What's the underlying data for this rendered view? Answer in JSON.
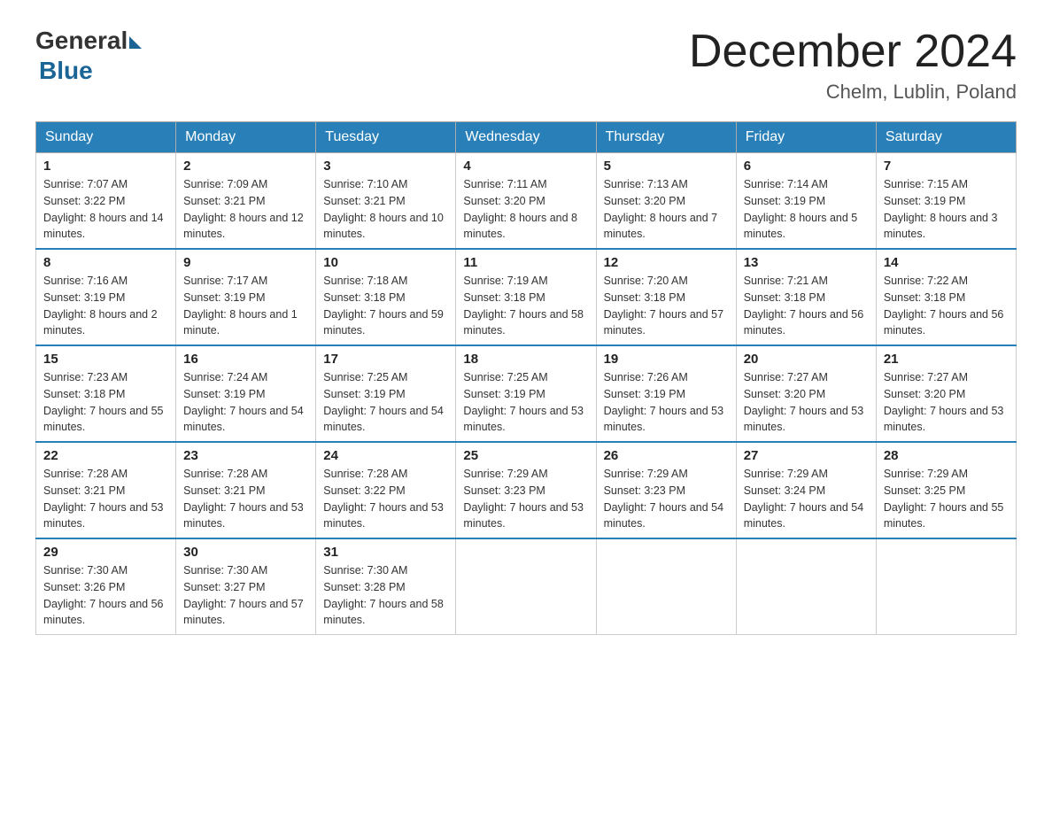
{
  "logo": {
    "general": "General",
    "blue": "Blue"
  },
  "title": {
    "month_year": "December 2024",
    "location": "Chelm, Lublin, Poland"
  },
  "days_of_week": [
    "Sunday",
    "Monday",
    "Tuesday",
    "Wednesday",
    "Thursday",
    "Friday",
    "Saturday"
  ],
  "weeks": [
    [
      {
        "day": "1",
        "sunrise": "7:07 AM",
        "sunset": "3:22 PM",
        "daylight": "8 hours and 14 minutes."
      },
      {
        "day": "2",
        "sunrise": "7:09 AM",
        "sunset": "3:21 PM",
        "daylight": "8 hours and 12 minutes."
      },
      {
        "day": "3",
        "sunrise": "7:10 AM",
        "sunset": "3:21 PM",
        "daylight": "8 hours and 10 minutes."
      },
      {
        "day": "4",
        "sunrise": "7:11 AM",
        "sunset": "3:20 PM",
        "daylight": "8 hours and 8 minutes."
      },
      {
        "day": "5",
        "sunrise": "7:13 AM",
        "sunset": "3:20 PM",
        "daylight": "8 hours and 7 minutes."
      },
      {
        "day": "6",
        "sunrise": "7:14 AM",
        "sunset": "3:19 PM",
        "daylight": "8 hours and 5 minutes."
      },
      {
        "day": "7",
        "sunrise": "7:15 AM",
        "sunset": "3:19 PM",
        "daylight": "8 hours and 3 minutes."
      }
    ],
    [
      {
        "day": "8",
        "sunrise": "7:16 AM",
        "sunset": "3:19 PM",
        "daylight": "8 hours and 2 minutes."
      },
      {
        "day": "9",
        "sunrise": "7:17 AM",
        "sunset": "3:19 PM",
        "daylight": "8 hours and 1 minute."
      },
      {
        "day": "10",
        "sunrise": "7:18 AM",
        "sunset": "3:18 PM",
        "daylight": "7 hours and 59 minutes."
      },
      {
        "day": "11",
        "sunrise": "7:19 AM",
        "sunset": "3:18 PM",
        "daylight": "7 hours and 58 minutes."
      },
      {
        "day": "12",
        "sunrise": "7:20 AM",
        "sunset": "3:18 PM",
        "daylight": "7 hours and 57 minutes."
      },
      {
        "day": "13",
        "sunrise": "7:21 AM",
        "sunset": "3:18 PM",
        "daylight": "7 hours and 56 minutes."
      },
      {
        "day": "14",
        "sunrise": "7:22 AM",
        "sunset": "3:18 PM",
        "daylight": "7 hours and 56 minutes."
      }
    ],
    [
      {
        "day": "15",
        "sunrise": "7:23 AM",
        "sunset": "3:18 PM",
        "daylight": "7 hours and 55 minutes."
      },
      {
        "day": "16",
        "sunrise": "7:24 AM",
        "sunset": "3:19 PM",
        "daylight": "7 hours and 54 minutes."
      },
      {
        "day": "17",
        "sunrise": "7:25 AM",
        "sunset": "3:19 PM",
        "daylight": "7 hours and 54 minutes."
      },
      {
        "day": "18",
        "sunrise": "7:25 AM",
        "sunset": "3:19 PM",
        "daylight": "7 hours and 53 minutes."
      },
      {
        "day": "19",
        "sunrise": "7:26 AM",
        "sunset": "3:19 PM",
        "daylight": "7 hours and 53 minutes."
      },
      {
        "day": "20",
        "sunrise": "7:27 AM",
        "sunset": "3:20 PM",
        "daylight": "7 hours and 53 minutes."
      },
      {
        "day": "21",
        "sunrise": "7:27 AM",
        "sunset": "3:20 PM",
        "daylight": "7 hours and 53 minutes."
      }
    ],
    [
      {
        "day": "22",
        "sunrise": "7:28 AM",
        "sunset": "3:21 PM",
        "daylight": "7 hours and 53 minutes."
      },
      {
        "day": "23",
        "sunrise": "7:28 AM",
        "sunset": "3:21 PM",
        "daylight": "7 hours and 53 minutes."
      },
      {
        "day": "24",
        "sunrise": "7:28 AM",
        "sunset": "3:22 PM",
        "daylight": "7 hours and 53 minutes."
      },
      {
        "day": "25",
        "sunrise": "7:29 AM",
        "sunset": "3:23 PM",
        "daylight": "7 hours and 53 minutes."
      },
      {
        "day": "26",
        "sunrise": "7:29 AM",
        "sunset": "3:23 PM",
        "daylight": "7 hours and 54 minutes."
      },
      {
        "day": "27",
        "sunrise": "7:29 AM",
        "sunset": "3:24 PM",
        "daylight": "7 hours and 54 minutes."
      },
      {
        "day": "28",
        "sunrise": "7:29 AM",
        "sunset": "3:25 PM",
        "daylight": "7 hours and 55 minutes."
      }
    ],
    [
      {
        "day": "29",
        "sunrise": "7:30 AM",
        "sunset": "3:26 PM",
        "daylight": "7 hours and 56 minutes."
      },
      {
        "day": "30",
        "sunrise": "7:30 AM",
        "sunset": "3:27 PM",
        "daylight": "7 hours and 57 minutes."
      },
      {
        "day": "31",
        "sunrise": "7:30 AM",
        "sunset": "3:28 PM",
        "daylight": "7 hours and 58 minutes."
      },
      null,
      null,
      null,
      null
    ]
  ],
  "labels": {
    "sunrise": "Sunrise:",
    "sunset": "Sunset:",
    "daylight": "Daylight:"
  }
}
